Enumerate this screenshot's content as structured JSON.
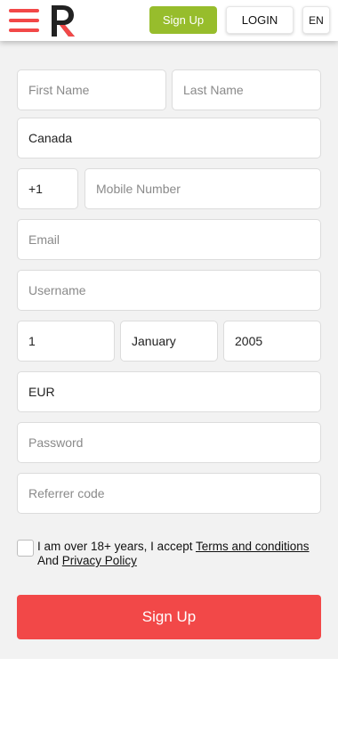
{
  "header": {
    "signup_label": "Sign Up",
    "login_label": "LOGIN",
    "language_label": "EN",
    "menu_icon": "hamburger-menu-icon",
    "logo_icon": "brand-logo-icon"
  },
  "form": {
    "first_name": {
      "placeholder": "First Name",
      "value": ""
    },
    "last_name": {
      "placeholder": "Last Name",
      "value": ""
    },
    "country": {
      "value": "Canada"
    },
    "phone_code": {
      "value": "+1"
    },
    "mobile": {
      "placeholder": "Mobile Number",
      "value": ""
    },
    "email": {
      "placeholder": "Email",
      "value": ""
    },
    "username": {
      "placeholder": "Username",
      "value": ""
    },
    "dob_day": {
      "value": "1"
    },
    "dob_month": {
      "value": "January"
    },
    "dob_year": {
      "value": "2005"
    },
    "currency": {
      "value": "EUR"
    },
    "password": {
      "placeholder": "Password",
      "value": ""
    },
    "referrer": {
      "placeholder": "Referrer code",
      "value": ""
    },
    "terms": {
      "prefix": "I am over 18+ years, I accept",
      "terms_link": "Terms and conditions",
      "and_text": "And",
      "privacy_link": "Privacy Policy",
      "checked": false
    },
    "submit_label": "Sign Up"
  },
  "colors": {
    "brand_red": "#f24848",
    "signup_green": "#97bd2c",
    "logo_dark": "#222222",
    "form_background": "#f2f2f2"
  }
}
